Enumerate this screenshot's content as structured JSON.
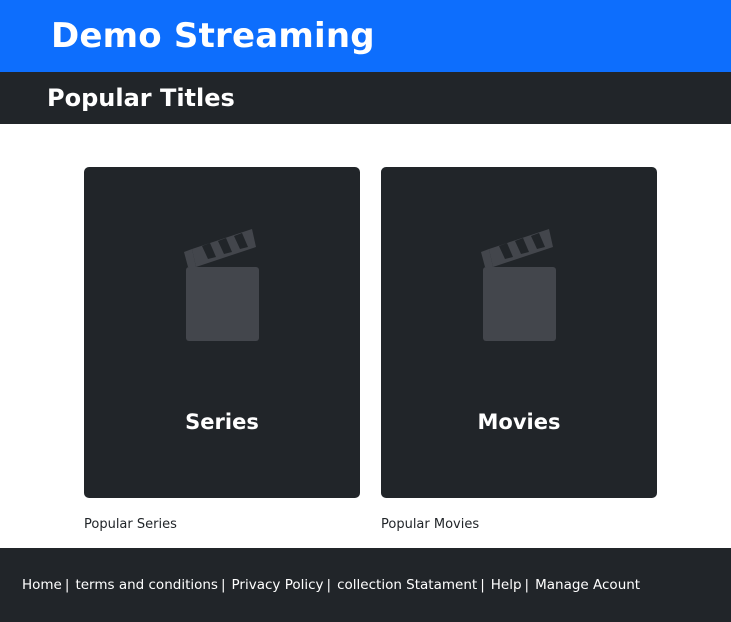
{
  "header": {
    "title": "Demo Streaming"
  },
  "subheader": {
    "title": "Popular Titles"
  },
  "cards": [
    {
      "label": "Series",
      "caption": "Popular Series",
      "icon": "clapperboard-icon"
    },
    {
      "label": "Movies",
      "caption": "Popular Movies",
      "icon": "clapperboard-icon"
    }
  ],
  "footer": {
    "links": [
      "Home",
      "terms and conditions",
      "Privacy Policy",
      "collection Statament",
      "Help",
      "Manage Acount"
    ],
    "separator": "|"
  },
  "colors": {
    "header_bg": "#0d6efd",
    "dark_bg": "#212529",
    "icon_fill": "#43464c"
  }
}
